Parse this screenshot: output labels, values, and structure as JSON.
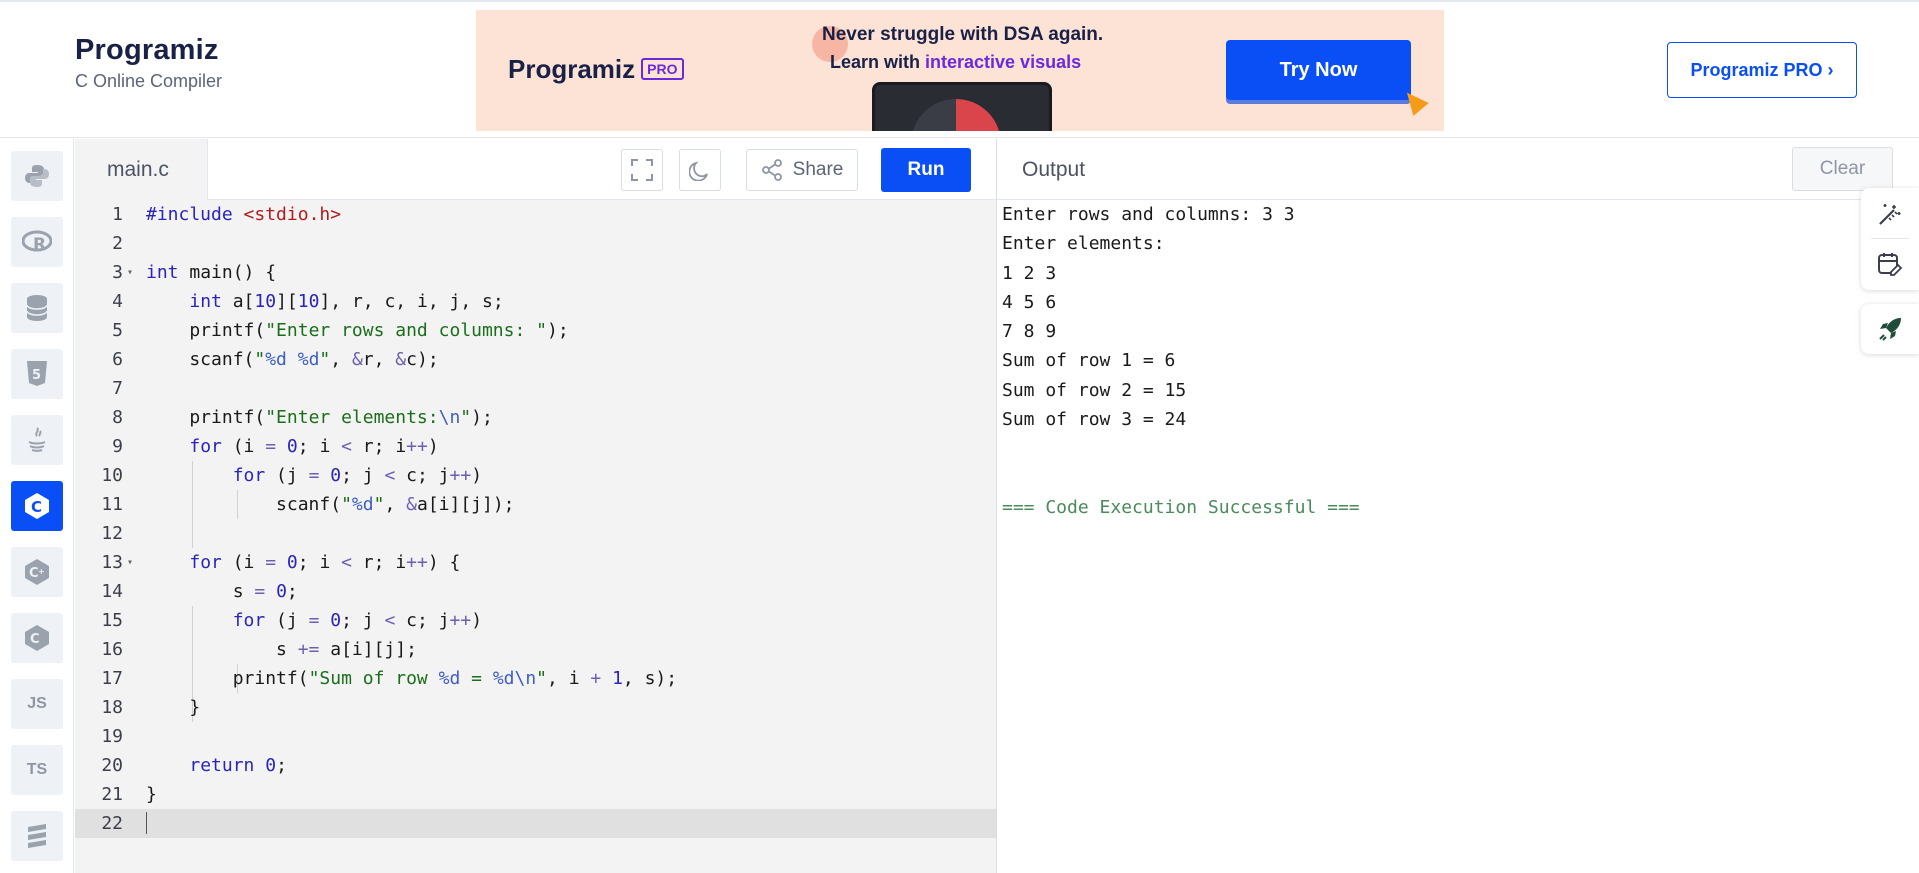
{
  "header": {
    "logo_text": "Programiz",
    "logo_sub": "C Online Compiler",
    "banner": {
      "logo_text": "Programiz",
      "pro_badge": "PRO",
      "line1": "Never struggle with DSA again.",
      "line2_prefix": "Learn with ",
      "line2_highlight": "interactive visuals",
      "cta": "Try Now"
    },
    "pro_button": "Programiz PRO ›"
  },
  "sidebar": {
    "items": [
      {
        "icon": "python-icon"
      },
      {
        "icon": "r-icon"
      },
      {
        "icon": "sql-icon"
      },
      {
        "icon": "html-icon"
      },
      {
        "icon": "java-icon"
      },
      {
        "icon": "c-icon",
        "active": true
      },
      {
        "icon": "cpp-icon"
      },
      {
        "icon": "csharp-icon"
      },
      {
        "icon": "js-icon",
        "label": "JS"
      },
      {
        "icon": "ts-icon",
        "label": "TS"
      },
      {
        "icon": "stack-icon"
      }
    ]
  },
  "editor": {
    "file_tab": "main.c",
    "share_label": "Share",
    "run_label": "Run",
    "lines": [
      "#include <stdio.h>",
      "",
      "int main() {",
      "    int a[10][10], r, c, i, j, s;",
      "    printf(\"Enter rows and columns: \");",
      "    scanf(\"%d %d\", &r, &c);",
      "",
      "    printf(\"Enter elements:\\n\");",
      "    for (i = 0; i < r; i++)",
      "        for (j = 0; j < c; j++)",
      "            scanf(\"%d\", &a[i][j]);",
      "",
      "    for (i = 0; i < r; i++) {",
      "        s = 0;",
      "        for (j = 0; j < c; j++)",
      "            s += a[i][j];",
      "        printf(\"Sum of row %d = %d\\n\", i + 1, s);",
      "    }",
      "",
      "    return 0;",
      "}",
      ""
    ],
    "current_line": 22
  },
  "output": {
    "title": "Output",
    "clear_label": "Clear",
    "lines": [
      "Enter rows and columns: 3 3",
      "Enter elements:",
      "1 2 3",
      "4 5 6",
      "7 8 9",
      "Sum of row 1 = 6",
      "Sum of row 2 = 15",
      "Sum of row 3 = 24",
      "",
      "",
      "=== Code Execution Successful ==="
    ]
  },
  "colors": {
    "accent": "#0a4ff5",
    "banner_bg": "#fde3d6",
    "success": "#4a8a5c"
  }
}
